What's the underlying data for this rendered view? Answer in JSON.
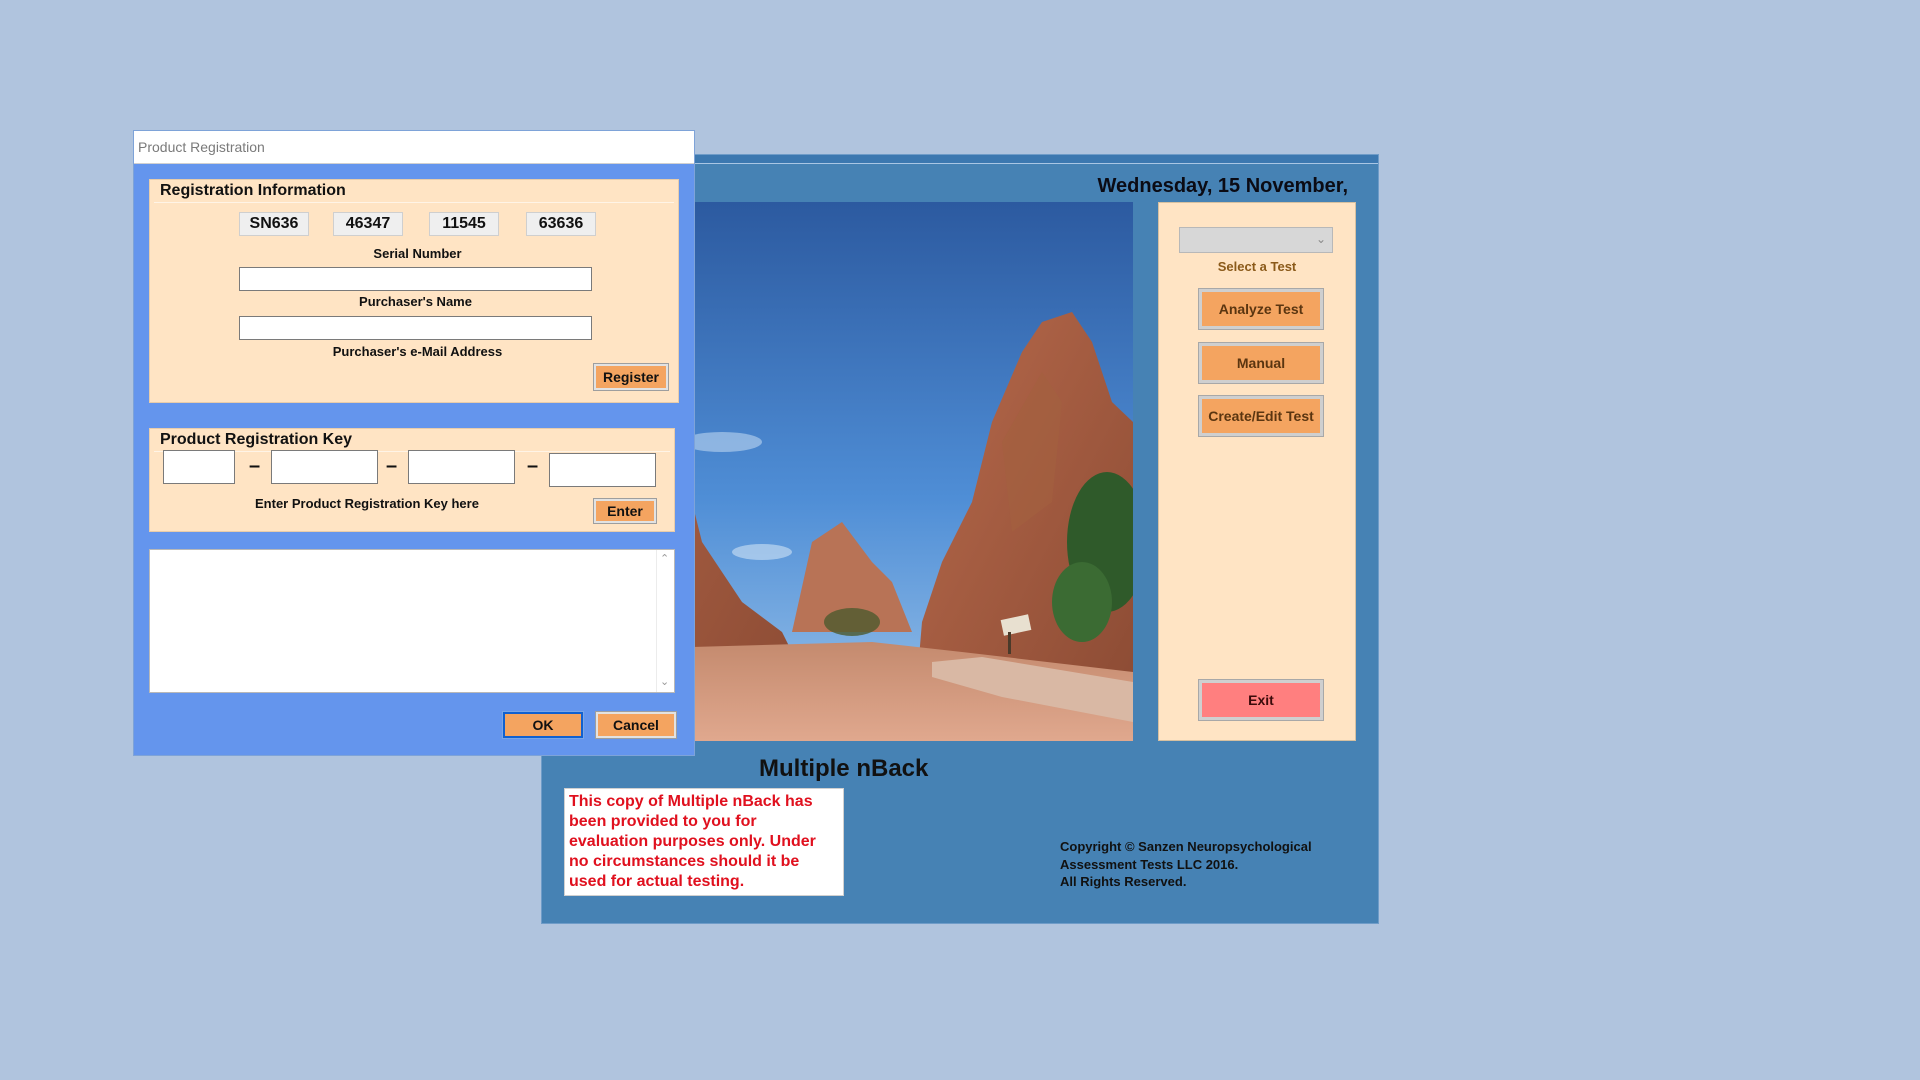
{
  "main": {
    "date": "Wednesday, 15 November,",
    "select_label": "Select a Test",
    "select_value": "",
    "buttons": {
      "analyze": "Analyze Test",
      "manual": "Manual",
      "create_edit": "Create/Edit Test",
      "exit": "Exit"
    },
    "app_title": "Multiple nBack",
    "eval_notice": "This copy of Multiple nBack has been provided to you for evaluation purposes only. Under no circumstances should it be used for actual testing.",
    "copyright": {
      "line1": "Copyright © Sanzen Neuropsychological",
      "line2": "Assessment Tests LLC 2016.",
      "line3": "All Rights Reserved."
    },
    "photo_icon": "red-rock-canyon-photo"
  },
  "dialog": {
    "title": "Product Registration",
    "registration_info": {
      "heading": "Registration Information",
      "serial": [
        "SN636",
        "46347",
        "11545",
        "63636"
      ],
      "serial_label": "Serial Number",
      "name_value": "",
      "name_label": "Purchaser's Name",
      "email_value": "",
      "email_label": "Purchaser's e-Mail Address",
      "register_button": "Register"
    },
    "registration_key": {
      "heading": "Product Registration Key",
      "parts": [
        "",
        "",
        "",
        ""
      ],
      "separator": "–",
      "hint": "Enter Product Registration Key here",
      "enter_button": "Enter"
    },
    "message_text": "",
    "ok_button": "OK",
    "cancel_button": "Cancel"
  },
  "colors": {
    "desktop": "#b0c4de",
    "main_window": "#4682b4",
    "dialog": "#6495ed",
    "panel": "#ffe4c4",
    "button": "#f4a460",
    "exit_button": "#ff7f7f",
    "notice_text": "#e0101e"
  }
}
